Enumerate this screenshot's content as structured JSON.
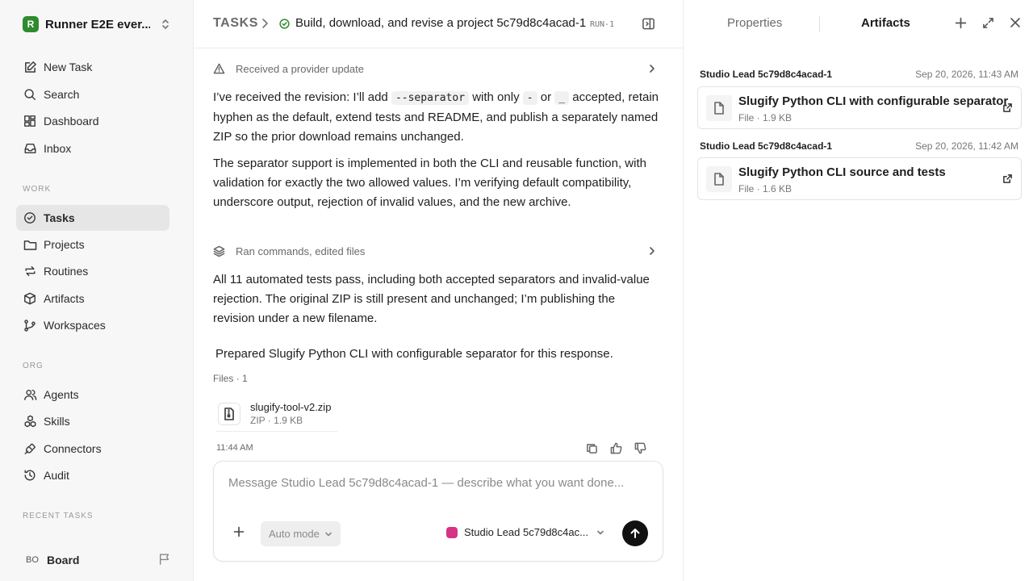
{
  "sidebar": {
    "workspace_name": "Runner E2E ever...",
    "workspace_logo": "R",
    "nav": [
      {
        "label": "New Task",
        "icon": "edit-icon"
      },
      {
        "label": "Search",
        "icon": "search-icon"
      },
      {
        "label": "Dashboard",
        "icon": "dashboard-icon"
      },
      {
        "label": "Inbox",
        "icon": "inbox-icon"
      }
    ],
    "work_label": "WORK",
    "work": [
      {
        "label": "Tasks",
        "icon": "check-circle-icon",
        "active": true
      },
      {
        "label": "Projects",
        "icon": "folder-icon"
      },
      {
        "label": "Routines",
        "icon": "repeat-icon"
      },
      {
        "label": "Artifacts",
        "icon": "box-icon"
      },
      {
        "label": "Workspaces",
        "icon": "branch-icon"
      }
    ],
    "org_label": "ORG",
    "org": [
      {
        "label": "Agents",
        "icon": "users-icon"
      },
      {
        "label": "Skills",
        "icon": "skills-icon"
      },
      {
        "label": "Connectors",
        "icon": "plug-icon"
      },
      {
        "label": "Audit",
        "icon": "history-icon"
      }
    ],
    "recent_label": "RECENT TASKS",
    "board": {
      "initials": "BO",
      "name": "Board"
    }
  },
  "header": {
    "root": "TASKS",
    "title": "Build, download, and revise a project 5c79d8c4acad-1",
    "run_id": "RUN-1"
  },
  "conversation": {
    "event1": "Received a provider update",
    "para1": {
      "t1": "I’ve received the revision: I’ll add ",
      "code1": "--separator",
      "t2": " with only ",
      "code2": "-",
      "t3": " or ",
      "code3": "_",
      "t4": " accepted, retain hyphen as the default, extend tests and README, and publish a separately named ZIP so the prior download remains unchanged."
    },
    "para2": "The separator support is implemented in both the CLI and reusable function, with validation for exactly the two allowed values. I’m verifying default compatibility, underscore output, rejection of invalid values, and the new archive.",
    "event2": "Ran commands, edited files",
    "para3": "All 11 automated tests pass, including both accepted separators and invalid-value rejection. The original ZIP is still present and unchanged; I’m publishing the revision under a new filename.",
    "para4": "Prepared Slugify Python CLI with configurable separator for this response.",
    "files_label": "Files · 1",
    "file": {
      "name": "slugify-tool-v2.zip",
      "meta": "ZIP · 1.9 KB"
    },
    "time": "11:44 AM"
  },
  "composer": {
    "placeholder": "Message Studio Lead 5c79d8c4acad-1 — describe what you want done...",
    "mode": "Auto mode",
    "agent": "Studio Lead 5c79d8c4ac..."
  },
  "panel": {
    "tabs": [
      "Properties",
      "Artifacts"
    ],
    "active_tab": "Artifacts",
    "artifacts": [
      {
        "agent": "Studio Lead 5c79d8c4acad-1",
        "date": "Sep 20, 2026, 11:43 AM",
        "title": "Slugify Python CLI with configurable separator",
        "meta": "File · 1.9 KB"
      },
      {
        "agent": "Studio Lead 5c79d8c4acad-1",
        "date": "Sep 20, 2026, 11:42 AM",
        "title": "Slugify Python CLI source and tests",
        "meta": "File · 1.6 KB"
      }
    ]
  },
  "colors": {
    "accent_green": "#2e8b2e",
    "agent_avatar": "#d63384",
    "send_button": "#111111"
  }
}
